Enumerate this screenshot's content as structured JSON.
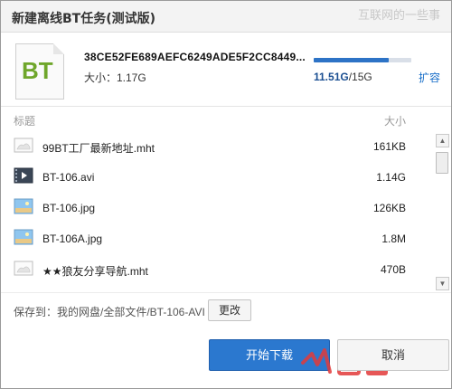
{
  "dialog": {
    "title": "新建离线BT任务(测试版)",
    "watermark": "互联网的一些事",
    "close_glyph": "×"
  },
  "torrent": {
    "icon_text": "BT",
    "hash": "38CE52FE689AEFC6249ADE5F2CC8449...",
    "size": "大小：1.17G"
  },
  "quota": {
    "used": "11.51G",
    "total": "/15G",
    "fill_fraction": 0.767,
    "expand_label": "扩容"
  },
  "list": {
    "header_title": "标题",
    "header_size": "大小",
    "files": [
      {
        "name": "99BT工厂最新地址.mht",
        "size": "161KB",
        "icon": "web-page-icon"
      },
      {
        "name": "BT-106.avi",
        "size": "1.14G",
        "icon": "video-file-icon"
      },
      {
        "name": "BT-106.jpg",
        "size": "126KB",
        "icon": "image-file-icon"
      },
      {
        "name": "BT-106A.jpg",
        "size": "1.8M",
        "icon": "image-file-icon"
      },
      {
        "name": "★★狼友分享导航.mht",
        "size": "470B",
        "icon": "web-page-icon"
      }
    ]
  },
  "save": {
    "label": "保存到：",
    "path": "我的网盘/全部文件/BT-106-AVI",
    "change_label": "更改"
  },
  "actions": {
    "start_label": "开始下载",
    "cancel_label": "取消"
  },
  "colors": {
    "accent": "#2b78cf",
    "bt_green": "#6fa62b",
    "link": "#1a6fc9"
  }
}
